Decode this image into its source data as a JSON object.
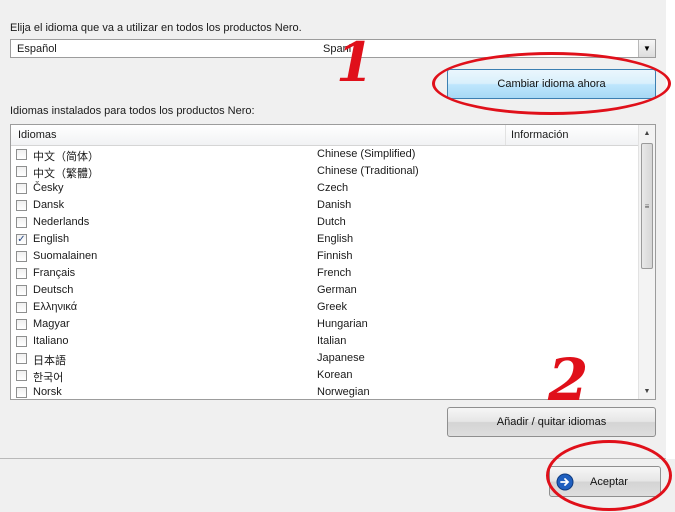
{
  "prompt_label": "Elija el idioma que va a utilizar en todos los productos Nero.",
  "language_select": {
    "value": "Español",
    "overlap_text": "Spani"
  },
  "change_language_button": "Cambiar idioma ahora",
  "installed_label": "Idiomas instalados para todos los productos Nero:",
  "list_headers": {
    "language": "Idiomas",
    "info": "Información"
  },
  "languages": [
    {
      "name": "中文（简体）",
      "english": "Chinese (Simplified)",
      "checked": false
    },
    {
      "name": "中文（繁體）",
      "english": "Chinese (Traditional)",
      "checked": false
    },
    {
      "name": "Česky",
      "english": "Czech",
      "checked": false
    },
    {
      "name": "Dansk",
      "english": "Danish",
      "checked": false
    },
    {
      "name": "Nederlands",
      "english": "Dutch",
      "checked": false
    },
    {
      "name": "English",
      "english": "English",
      "checked": true
    },
    {
      "name": "Suomalainen",
      "english": "Finnish",
      "checked": false
    },
    {
      "name": "Français",
      "english": "French",
      "checked": false
    },
    {
      "name": "Deutsch",
      "english": "German",
      "checked": false
    },
    {
      "name": "Ελληνικά",
      "english": "Greek",
      "checked": false
    },
    {
      "name": "Magyar",
      "english": "Hungarian",
      "checked": false
    },
    {
      "name": "Italiano",
      "english": "Italian",
      "checked": false
    },
    {
      "name": "日本語",
      "english": "Japanese",
      "checked": false
    },
    {
      "name": "한국어",
      "english": "Korean",
      "checked": false
    },
    {
      "name": "Norsk",
      "english": "Norwegian",
      "checked": false
    }
  ],
  "add_remove_button": "Añadir / quitar idiomas",
  "accept_button": "Aceptar",
  "annotations": {
    "step1": "1",
    "step2": "2"
  },
  "colors": {
    "annotation": "#e0101a",
    "accent_button": "#a7d9f5",
    "accept_icon": "#1f5fbf"
  }
}
